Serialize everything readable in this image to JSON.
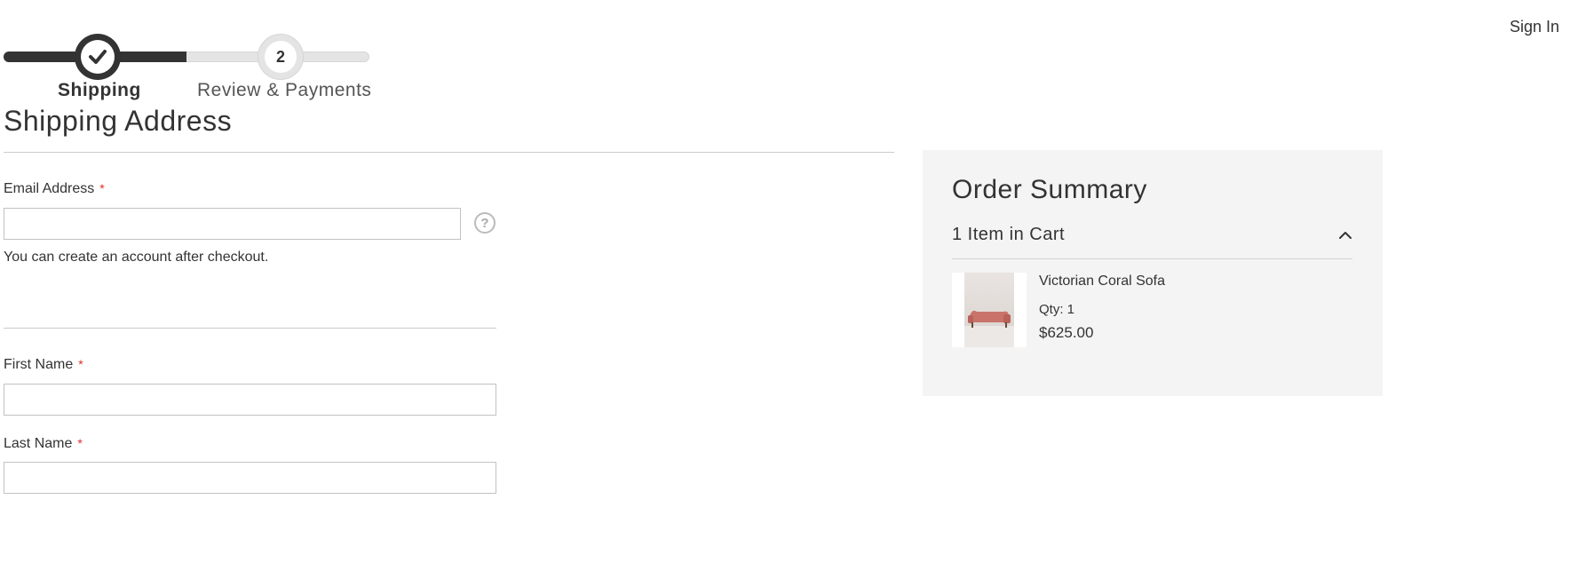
{
  "progress": {
    "steps": [
      {
        "label": "Shipping",
        "number": "1",
        "status": "complete"
      },
      {
        "label": "Review & Payments",
        "number": "2",
        "status": "pending"
      }
    ]
  },
  "header": {
    "sign_in": "Sign In"
  },
  "shipping": {
    "title": "Shipping Address",
    "email_label": "Email Address",
    "email_value": "",
    "email_note": "You can create an account after checkout.",
    "first_name_label": "First Name",
    "first_name_value": "",
    "last_name_label": "Last Name",
    "last_name_value": "",
    "required_mark": "*"
  },
  "summary": {
    "title": "Order Summary",
    "cart_count": "1 Item in Cart",
    "item": {
      "name": "Victorian Coral Sofa",
      "qty": "Qty: 1",
      "price": "$625.00"
    }
  },
  "colors": {
    "accent_dark": "#333333",
    "required": "#e02b27",
    "summary_bg": "#f4f4f4",
    "sofa": "#c9736b"
  },
  "icons": {
    "step_1": "checkmark-icon",
    "help": "question-circle-icon",
    "cart_toggle": "chevron-up-icon"
  }
}
